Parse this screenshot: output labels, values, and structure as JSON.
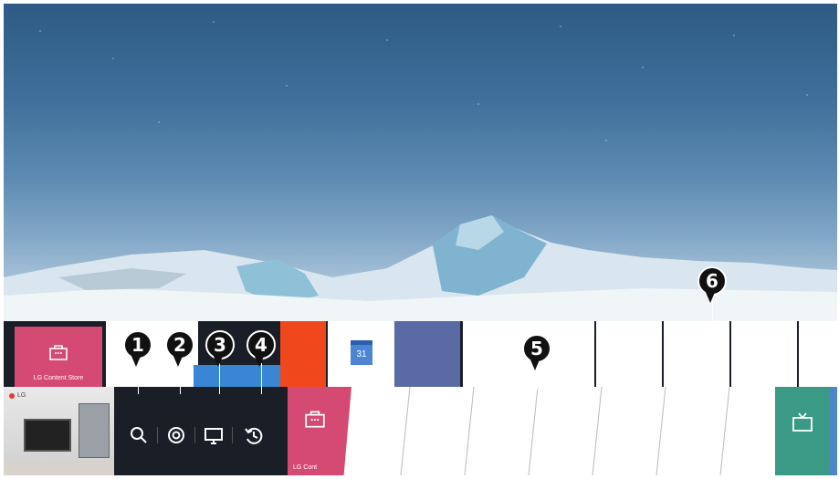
{
  "recents_row": {
    "lg_content_store_label": "LG Content Store",
    "calendar_tile": {
      "icon": "calendar-icon",
      "day": "31"
    }
  },
  "launcher_bar": {
    "featured_brand": "LG",
    "toolbar_icons": [
      "search-icon",
      "settings-icon",
      "input-icon",
      "recent-icon"
    ],
    "lg_store_button_label": "LG Cont",
    "colors": {
      "pink": "#d44a72",
      "green": "#3a9a86",
      "orange": "#f0481c",
      "slate": "#5a6aa4"
    }
  },
  "callouts": [
    "1",
    "2",
    "3",
    "4",
    "5",
    "6"
  ]
}
